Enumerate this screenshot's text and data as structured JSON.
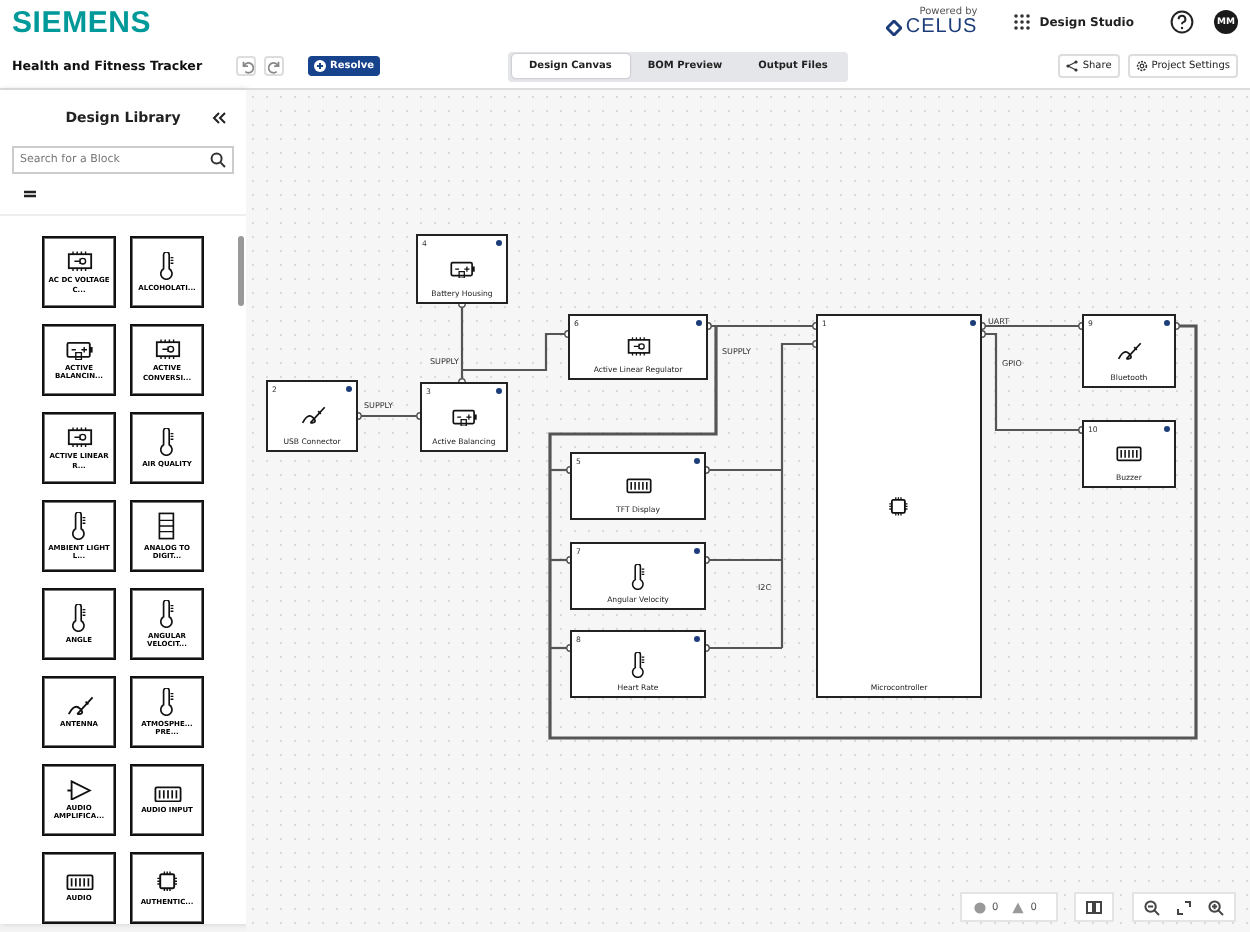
{
  "header": {
    "logo": "SIEMENS",
    "powered_by": "Powered by",
    "partner": "CELUS",
    "app_menu": "Design Studio",
    "avatar": "MM"
  },
  "toolbar": {
    "project_title": "Health and Fitness Tracker",
    "resolve": "Resolve",
    "share": "Share",
    "settings": "Project Settings",
    "tabs": [
      {
        "label": "Design Canvas",
        "selected": true
      },
      {
        "label": "BOM Preview",
        "selected": false
      },
      {
        "label": "Output Files",
        "selected": false
      }
    ]
  },
  "library": {
    "title": "Design Library",
    "search_placeholder": "Search for a Block",
    "blocks": [
      {
        "label": "AC DC VOLTAGE C...",
        "kind": "chip"
      },
      {
        "label": "ALCOHOLATI...",
        "kind": "thermometer"
      },
      {
        "label": "ACTIVE BALANCIN...",
        "kind": "battery"
      },
      {
        "label": "ACTIVE CONVERSI...",
        "kind": "chip"
      },
      {
        "label": "ACTIVE LINEAR R...",
        "kind": "chip"
      },
      {
        "label": "AIR QUALITY",
        "kind": "thermometer"
      },
      {
        "label": "AMBIENT LIGHT L...",
        "kind": "thermometer"
      },
      {
        "label": "ANALOG TO DIGIT...",
        "kind": "adc"
      },
      {
        "label": "ANGLE",
        "kind": "thermometer"
      },
      {
        "label": "ANGULAR VELOCIT...",
        "kind": "thermometer"
      },
      {
        "label": "ANTENNA",
        "kind": "antenna"
      },
      {
        "label": "ATMOSPHE... PRE...",
        "kind": "thermometer"
      },
      {
        "label": "AUDIO AMPLIFICA...",
        "kind": "amplifier"
      },
      {
        "label": "AUDIO INPUT",
        "kind": "connector"
      },
      {
        "label": "AUDIO",
        "kind": "connector"
      },
      {
        "label": "AUTHENTIC...",
        "kind": "processor"
      }
    ]
  },
  "canvas": {
    "blocks": [
      {
        "number": "2",
        "label": "USB Connector",
        "kind": "antenna"
      },
      {
        "number": "4",
        "label": "Battery Housing",
        "kind": "battery"
      },
      {
        "number": "3",
        "label": "Active Balancing",
        "kind": "battery"
      },
      {
        "number": "6",
        "label": "Active Linear Regulator",
        "kind": "chip"
      },
      {
        "number": "5",
        "label": "TFT Display",
        "kind": "connector"
      },
      {
        "number": "7",
        "label": "Angular Velocity",
        "kind": "thermometer"
      },
      {
        "number": "8",
        "label": "Heart Rate",
        "kind": "thermometer"
      },
      {
        "number": "1",
        "label": "Microcontroller",
        "kind": "processor"
      },
      {
        "number": "9",
        "label": "Bluetooth",
        "kind": "antenna"
      },
      {
        "number": "10",
        "label": "Buzzer",
        "kind": "connector"
      }
    ],
    "wire_labels": [
      "SUPPLY",
      "SUPPLY",
      "SUPPLY",
      "I2C",
      "UART",
      "GPIO"
    ]
  },
  "status": {
    "errors": "0",
    "warnings": "0"
  }
}
